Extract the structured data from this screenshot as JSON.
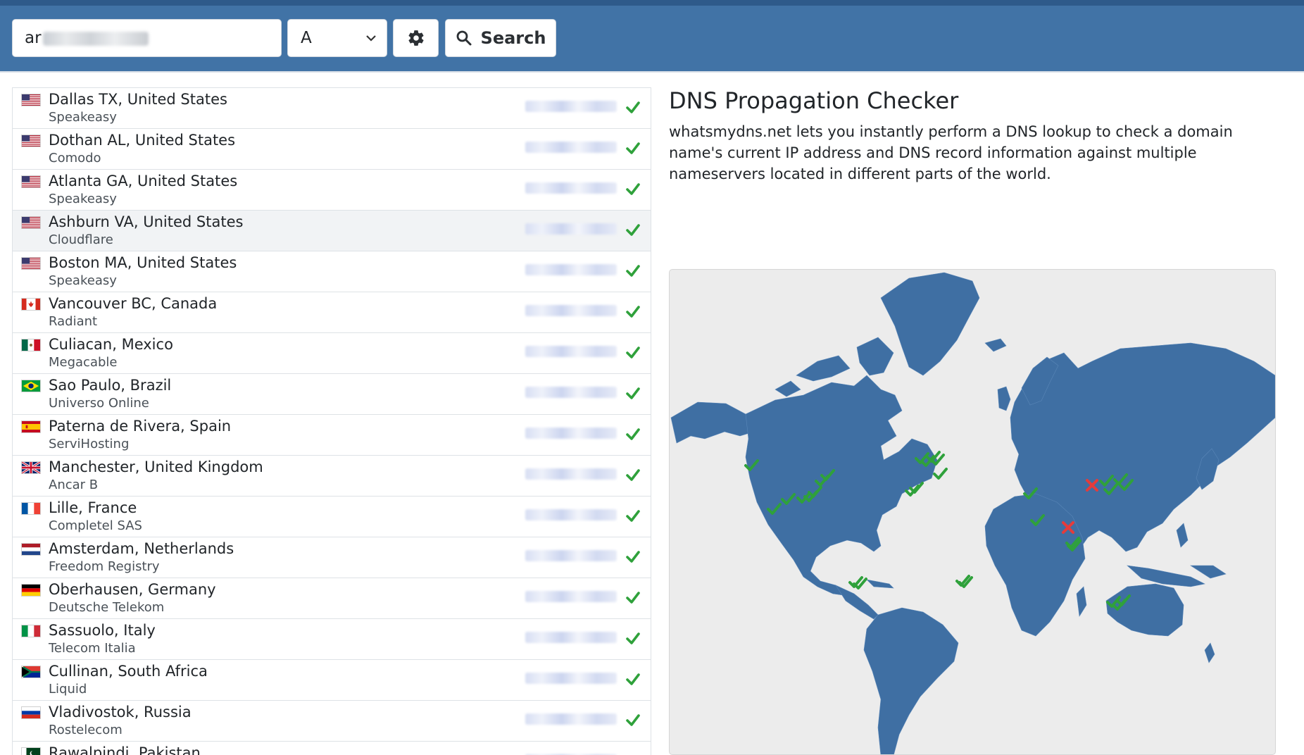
{
  "colors": {
    "header_bg": "#4173a6",
    "map_land": "#3f6fa3",
    "check": "#2fa13b",
    "fail": "#e53b3b"
  },
  "search": {
    "domain_value": "ar",
    "record_type": "A",
    "search_label": "Search",
    "settings_icon": "gear-icon",
    "search_icon": "magnifier-icon"
  },
  "results": [
    {
      "location": "Dallas TX, United States",
      "provider": "Speakeasy",
      "flag": "us",
      "status": "ok"
    },
    {
      "location": "Dothan AL, United States",
      "provider": "Comodo",
      "flag": "us",
      "status": "ok"
    },
    {
      "location": "Atlanta GA, United States",
      "provider": "Speakeasy",
      "flag": "us",
      "status": "ok"
    },
    {
      "location": "Ashburn VA, United States",
      "provider": "Cloudflare",
      "flag": "us",
      "status": "ok"
    },
    {
      "location": "Boston MA, United States",
      "provider": "Speakeasy",
      "flag": "us",
      "status": "ok"
    },
    {
      "location": "Vancouver BC, Canada",
      "provider": "Radiant",
      "flag": "ca",
      "status": "ok"
    },
    {
      "location": "Culiacan, Mexico",
      "provider": "Megacable",
      "flag": "mx",
      "status": "ok"
    },
    {
      "location": "Sao Paulo, Brazil",
      "provider": "Universo Online",
      "flag": "br",
      "status": "ok"
    },
    {
      "location": "Paterna de Rivera, Spain",
      "provider": "ServiHosting",
      "flag": "es",
      "status": "ok"
    },
    {
      "location": "Manchester, United Kingdom",
      "provider": "Ancar B",
      "flag": "gb",
      "status": "ok"
    },
    {
      "location": "Lille, France",
      "provider": "Completel SAS",
      "flag": "fr",
      "status": "ok"
    },
    {
      "location": "Amsterdam, Netherlands",
      "provider": "Freedom Registry",
      "flag": "nl",
      "status": "ok"
    },
    {
      "location": "Oberhausen, Germany",
      "provider": "Deutsche Telekom",
      "flag": "de",
      "status": "ok"
    },
    {
      "location": "Sassuolo, Italy",
      "provider": "Telecom Italia",
      "flag": "it",
      "status": "ok"
    },
    {
      "location": "Cullinan, South Africa",
      "provider": "Liquid",
      "flag": "za",
      "status": "ok"
    },
    {
      "location": "Vladivostok, Russia",
      "provider": "Rostelecom",
      "flag": "ru",
      "status": "ok"
    },
    {
      "location": "Rawalpindi, Pakistan",
      "provider": "",
      "flag": "pk",
      "status": "ok"
    }
  ],
  "info": {
    "title": "DNS Propagation Checker",
    "description": "whatsmydns.net lets you instantly perform a DNS lookup to check a domain name's current IP address and DNS record information against multiple nameservers located in different parts of the world."
  },
  "map": {
    "markers_ok": 30,
    "markers_fail": 2
  }
}
